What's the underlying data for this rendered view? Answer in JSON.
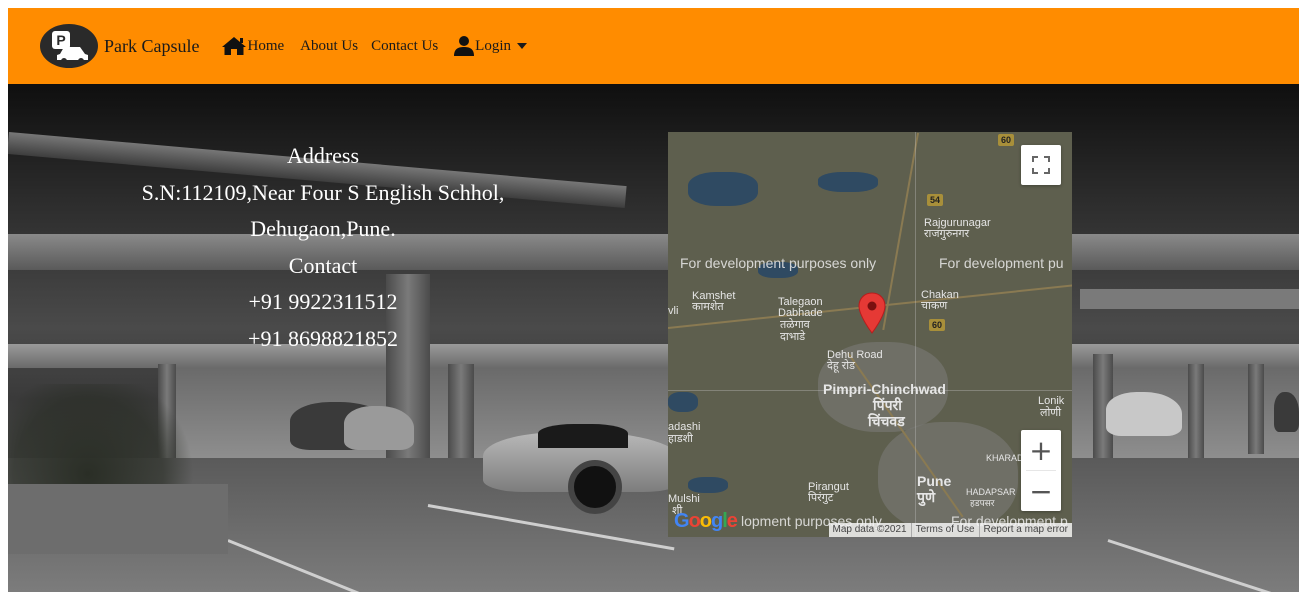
{
  "navbar": {
    "bg_color": "#ff8c00",
    "brand": {
      "logo_letter": "P",
      "name": "Park Capsule"
    },
    "links": {
      "home": "Home",
      "about": "About Us",
      "contact": "Contact Us",
      "login": "Login"
    }
  },
  "address_block": {
    "address_heading": "Address",
    "address_line1": "S.N:112109,Near Four S English Schhol,",
    "address_line2": "Dehugaon,Pune.",
    "contact_heading": "Contact",
    "phone1": "+91 9922311512",
    "phone2": "+91 8698821852"
  },
  "map": {
    "watermarks": [
      "For development purposes only",
      "For development pu",
      "lopment purposes only",
      "For development p"
    ],
    "places": {
      "rajgurunagar_en": "Rajgurunagar",
      "rajgurunagar_hi": "राजगुरुनगर",
      "kamshet_en": "Kamshet",
      "kamshet_hi": "कामशेत",
      "vli": "vli",
      "talegaon_en1": "Talegaon",
      "talegaon_en2": "Dabhade",
      "talegaon_hi1": "तळेगाव",
      "talegaon_hi2": "दाभाडे",
      "chakan_en": "Chakan",
      "chakan_hi": "चाकण",
      "dehu_en": "Dehu Road",
      "dehu_hi": "देहू रोड",
      "pimpri_en": "Pimpri-Chinchwad",
      "pimpri_hi1": "पिंपरी",
      "pimpri_hi2": "चिंचवड",
      "lonik_en": "Lonik",
      "lonik_hi": "लोणी",
      "hadashi_en": "adashi",
      "hadashi_hi": "हाडशी",
      "kharadi": "KHARADI",
      "pirangut_en": "Pirangut",
      "pirangut_hi": "पिरंगुट",
      "pune_en": "Pune",
      "pune_hi": "पुणे",
      "hadapsar_en": "HADAPSAR",
      "hadapsar_hi": "हडपसर",
      "mulshi_en": "Mulshi",
      "mulshi_hi": "शी"
    },
    "highways": {
      "h60a": "60",
      "h54": "54",
      "h60b": "60"
    },
    "controls": {
      "zoom_in": "+",
      "zoom_out": "−"
    },
    "logo_text": "Google",
    "attribution": {
      "map_data": "Map data ©2021",
      "terms": "Terms of Use",
      "report": "Report a map error"
    }
  },
  "icons": [
    "logo-car-icon",
    "home-icon",
    "user-icon",
    "caret-down-icon",
    "fullscreen-icon",
    "map-pin-icon"
  ]
}
